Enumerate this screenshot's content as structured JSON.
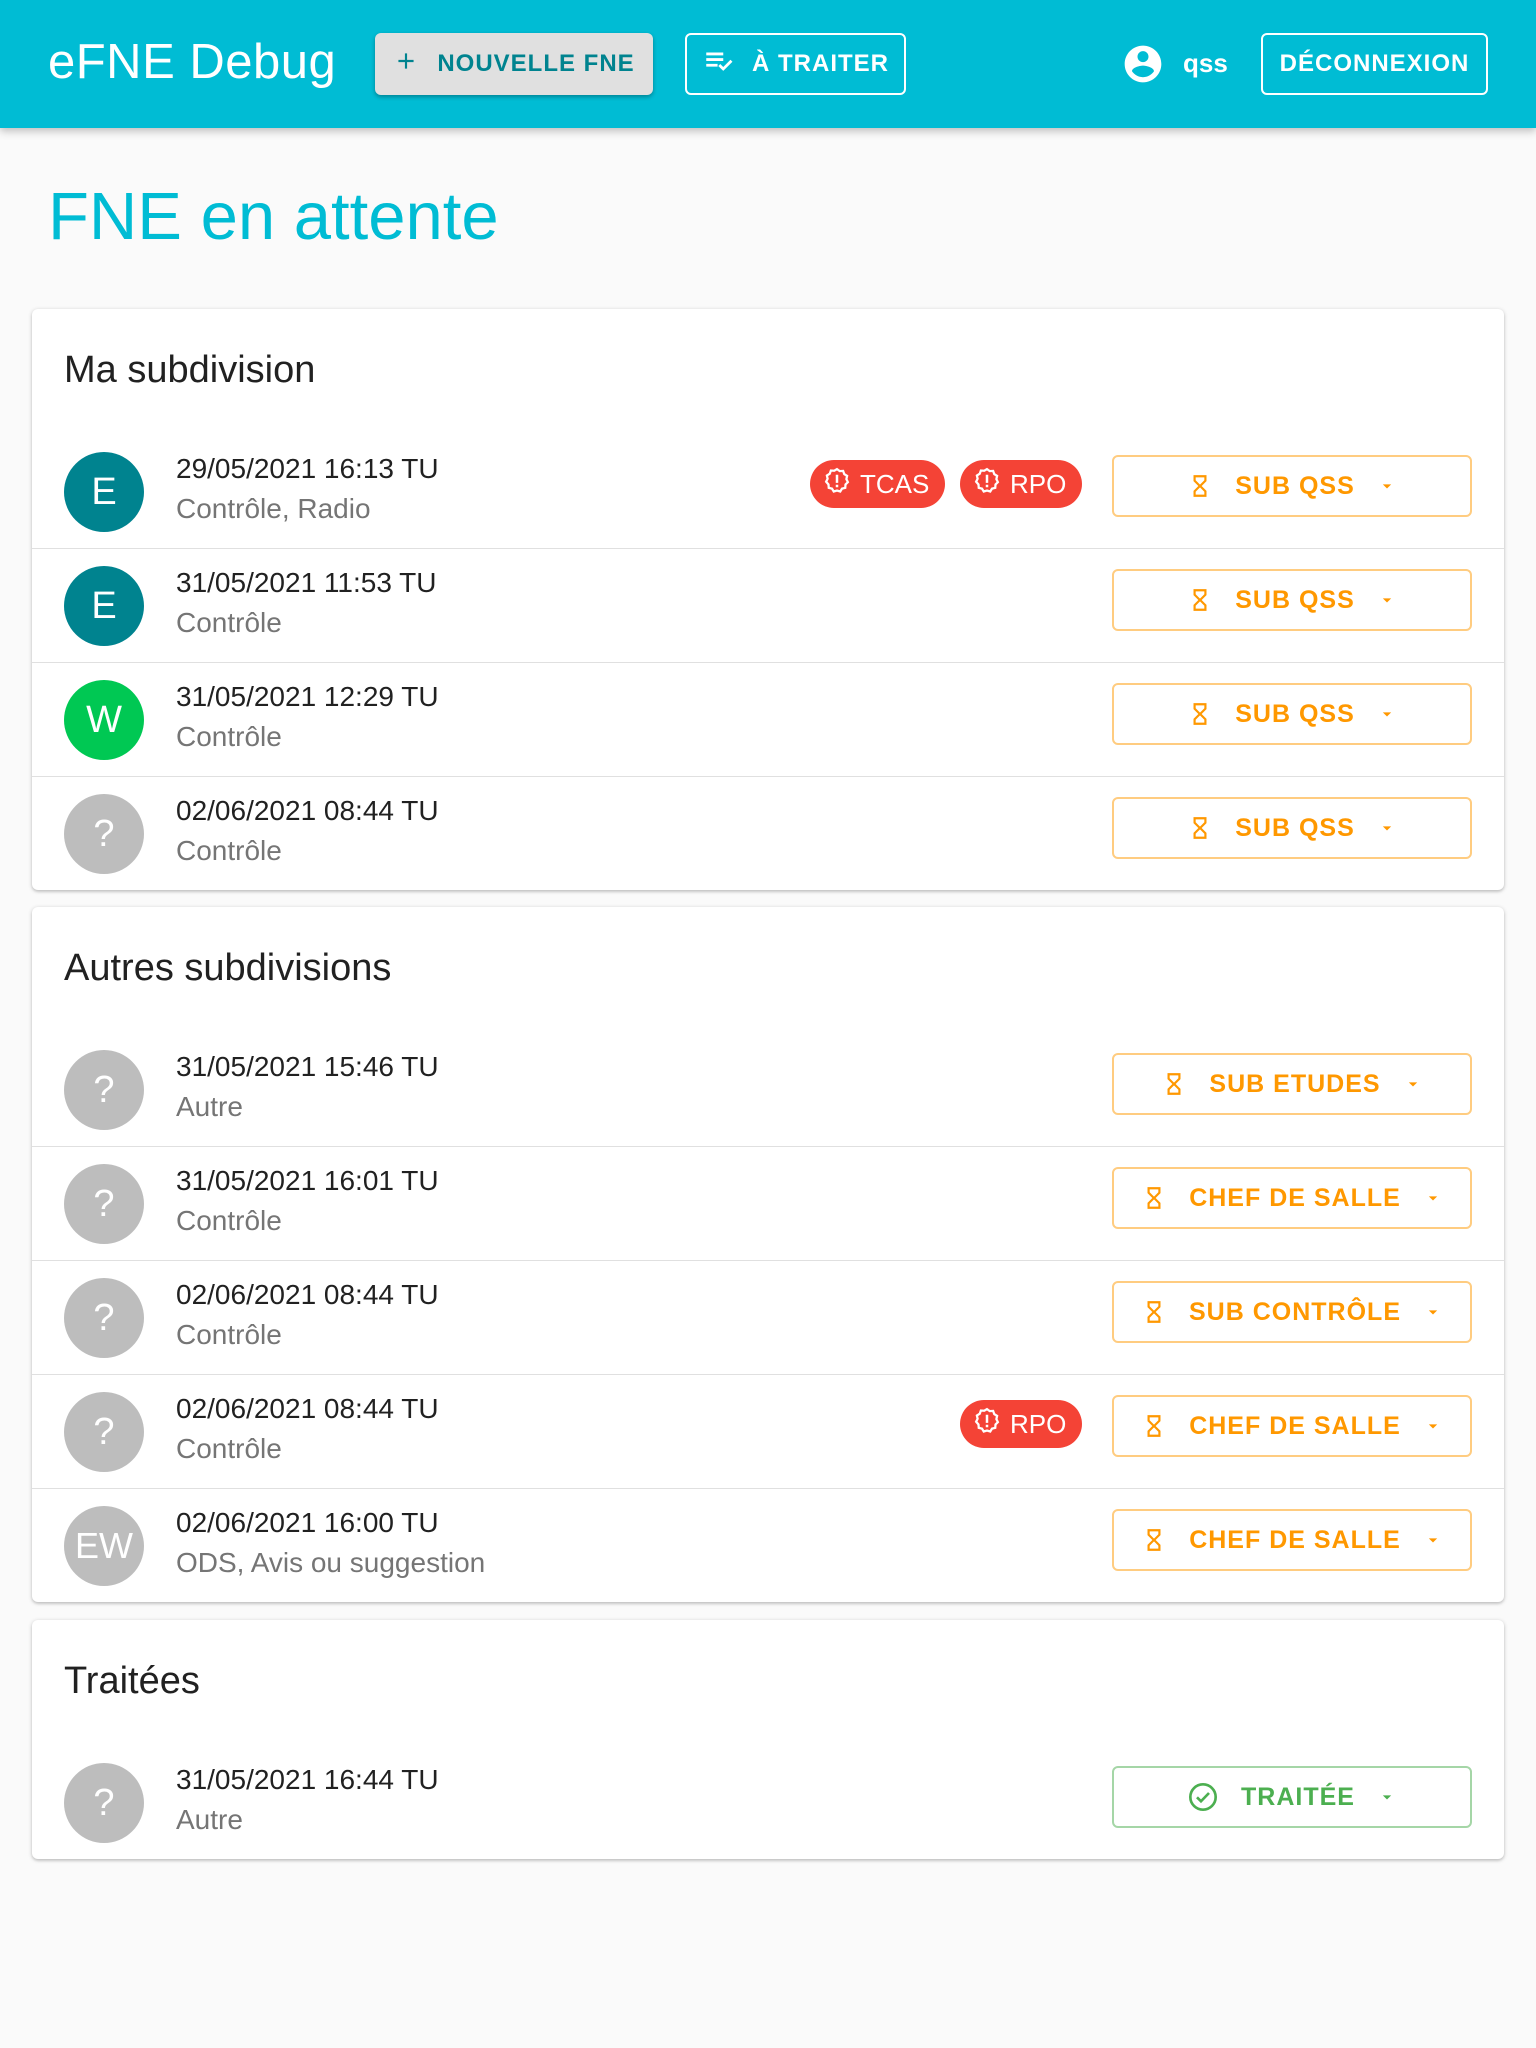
{
  "app": {
    "title": "eFNE Debug",
    "new_button": "NOUVELLE FNE",
    "todo_button": "À TRAITER",
    "user": "qss",
    "logout_button": "DÉCONNEXION"
  },
  "page_title": "FNE en attente",
  "colors": {
    "primary": "#00bcd4",
    "pending": "#ff9800",
    "done": "#4caf50",
    "alert": "#f44336"
  },
  "sections": {
    "mine": {
      "title": "Ma subdivision",
      "rows": [
        {
          "avatar": "E",
          "date": "29/05/2021 16:13 TU",
          "category": "Contrôle, Radio",
          "chips": [
            "TCAS",
            "RPO"
          ],
          "status": "SUB QSS"
        },
        {
          "avatar": "E",
          "date": "31/05/2021 11:53 TU",
          "category": "Contrôle",
          "status": "SUB QSS"
        },
        {
          "avatar": "W",
          "date": "31/05/2021 12:29 TU",
          "category": "Contrôle",
          "status": "SUB QSS"
        },
        {
          "avatar": "?",
          "date": "02/06/2021 08:44 TU",
          "category": "Contrôle",
          "status": "SUB QSS"
        }
      ]
    },
    "others": {
      "title": "Autres subdivisions",
      "rows": [
        {
          "avatar": "?",
          "date": "31/05/2021 15:46 TU",
          "category": "Autre",
          "status": "SUB ETUDES"
        },
        {
          "avatar": "?",
          "date": "31/05/2021 16:01 TU",
          "category": "Contrôle",
          "status": "CHEF DE SALLE"
        },
        {
          "avatar": "?",
          "date": "02/06/2021 08:44 TU",
          "category": "Contrôle",
          "status": "SUB CONTRÔLE"
        },
        {
          "avatar": "?",
          "date": "02/06/2021 08:44 TU",
          "category": "Contrôle",
          "chips": [
            "RPO"
          ],
          "status": "CHEF DE SALLE"
        },
        {
          "avatar": "EW",
          "date": "02/06/2021 16:00 TU",
          "category": "ODS, Avis ou suggestion",
          "status": "CHEF DE SALLE"
        }
      ]
    },
    "done": {
      "title": "Traitées",
      "rows": [
        {
          "avatar": "?",
          "date": "31/05/2021 16:44 TU",
          "category": "Autre",
          "status": "TRAITÉE"
        }
      ]
    }
  }
}
